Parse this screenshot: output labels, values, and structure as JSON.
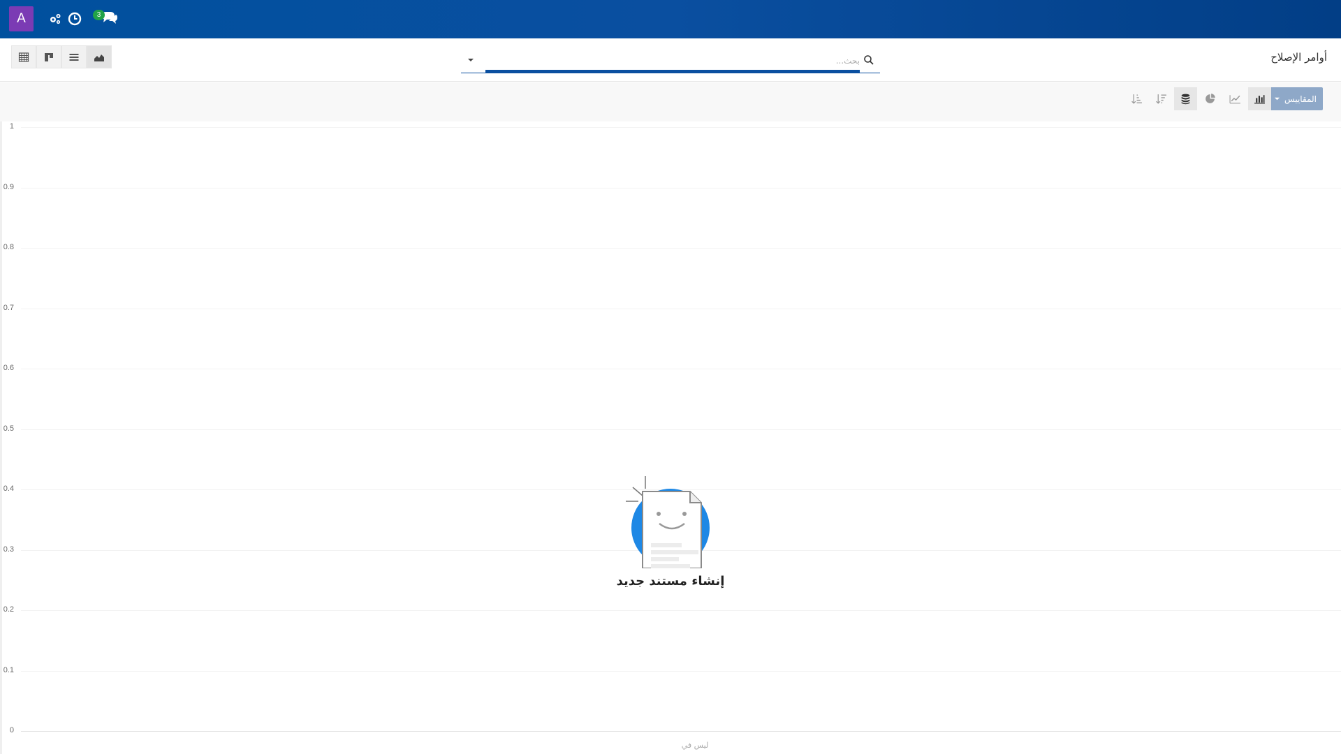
{
  "navbar": {
    "avatar_letter": "A",
    "avatar_color": "#7b3bb4",
    "messages_badge": "3",
    "icons": [
      "settings-gears-icon",
      "clock-icon",
      "chat-icon"
    ]
  },
  "breadcrumb": {
    "title": "أوامر الإصلاح"
  },
  "search": {
    "placeholder": "بحث..."
  },
  "view_switcher": {
    "views": [
      "pivot-view",
      "kanban-view",
      "list-view",
      "graph-view"
    ],
    "active": "graph-view"
  },
  "graph_toolbar": {
    "measures_label": "المقاييس",
    "chart_types": [
      "bar-chart-icon",
      "line-chart-icon",
      "pie-chart-icon"
    ],
    "active_chart": "bar-chart-icon",
    "stacked_icon": "database-stack-icon",
    "sort_icons": [
      "sort-descending-icon",
      "sort-ascending-icon"
    ]
  },
  "chart_data": {
    "type": "bar",
    "categories": [],
    "values": [],
    "ylim": [
      0,
      1
    ],
    "yticks": [
      "0",
      "0.1",
      "0.2",
      "0.3",
      "0.4",
      "0.5",
      "0.6",
      "0.7",
      "0.8",
      "0.9",
      "1"
    ],
    "xlabel": "ليس في"
  },
  "empty_state": {
    "title": "إنشاء مستند جديد"
  },
  "colors": {
    "navbar": "#0a4fa0",
    "measures_button": "#8ea8c8",
    "badge": "#22a347",
    "illustration_circle": "#1e88e5"
  }
}
